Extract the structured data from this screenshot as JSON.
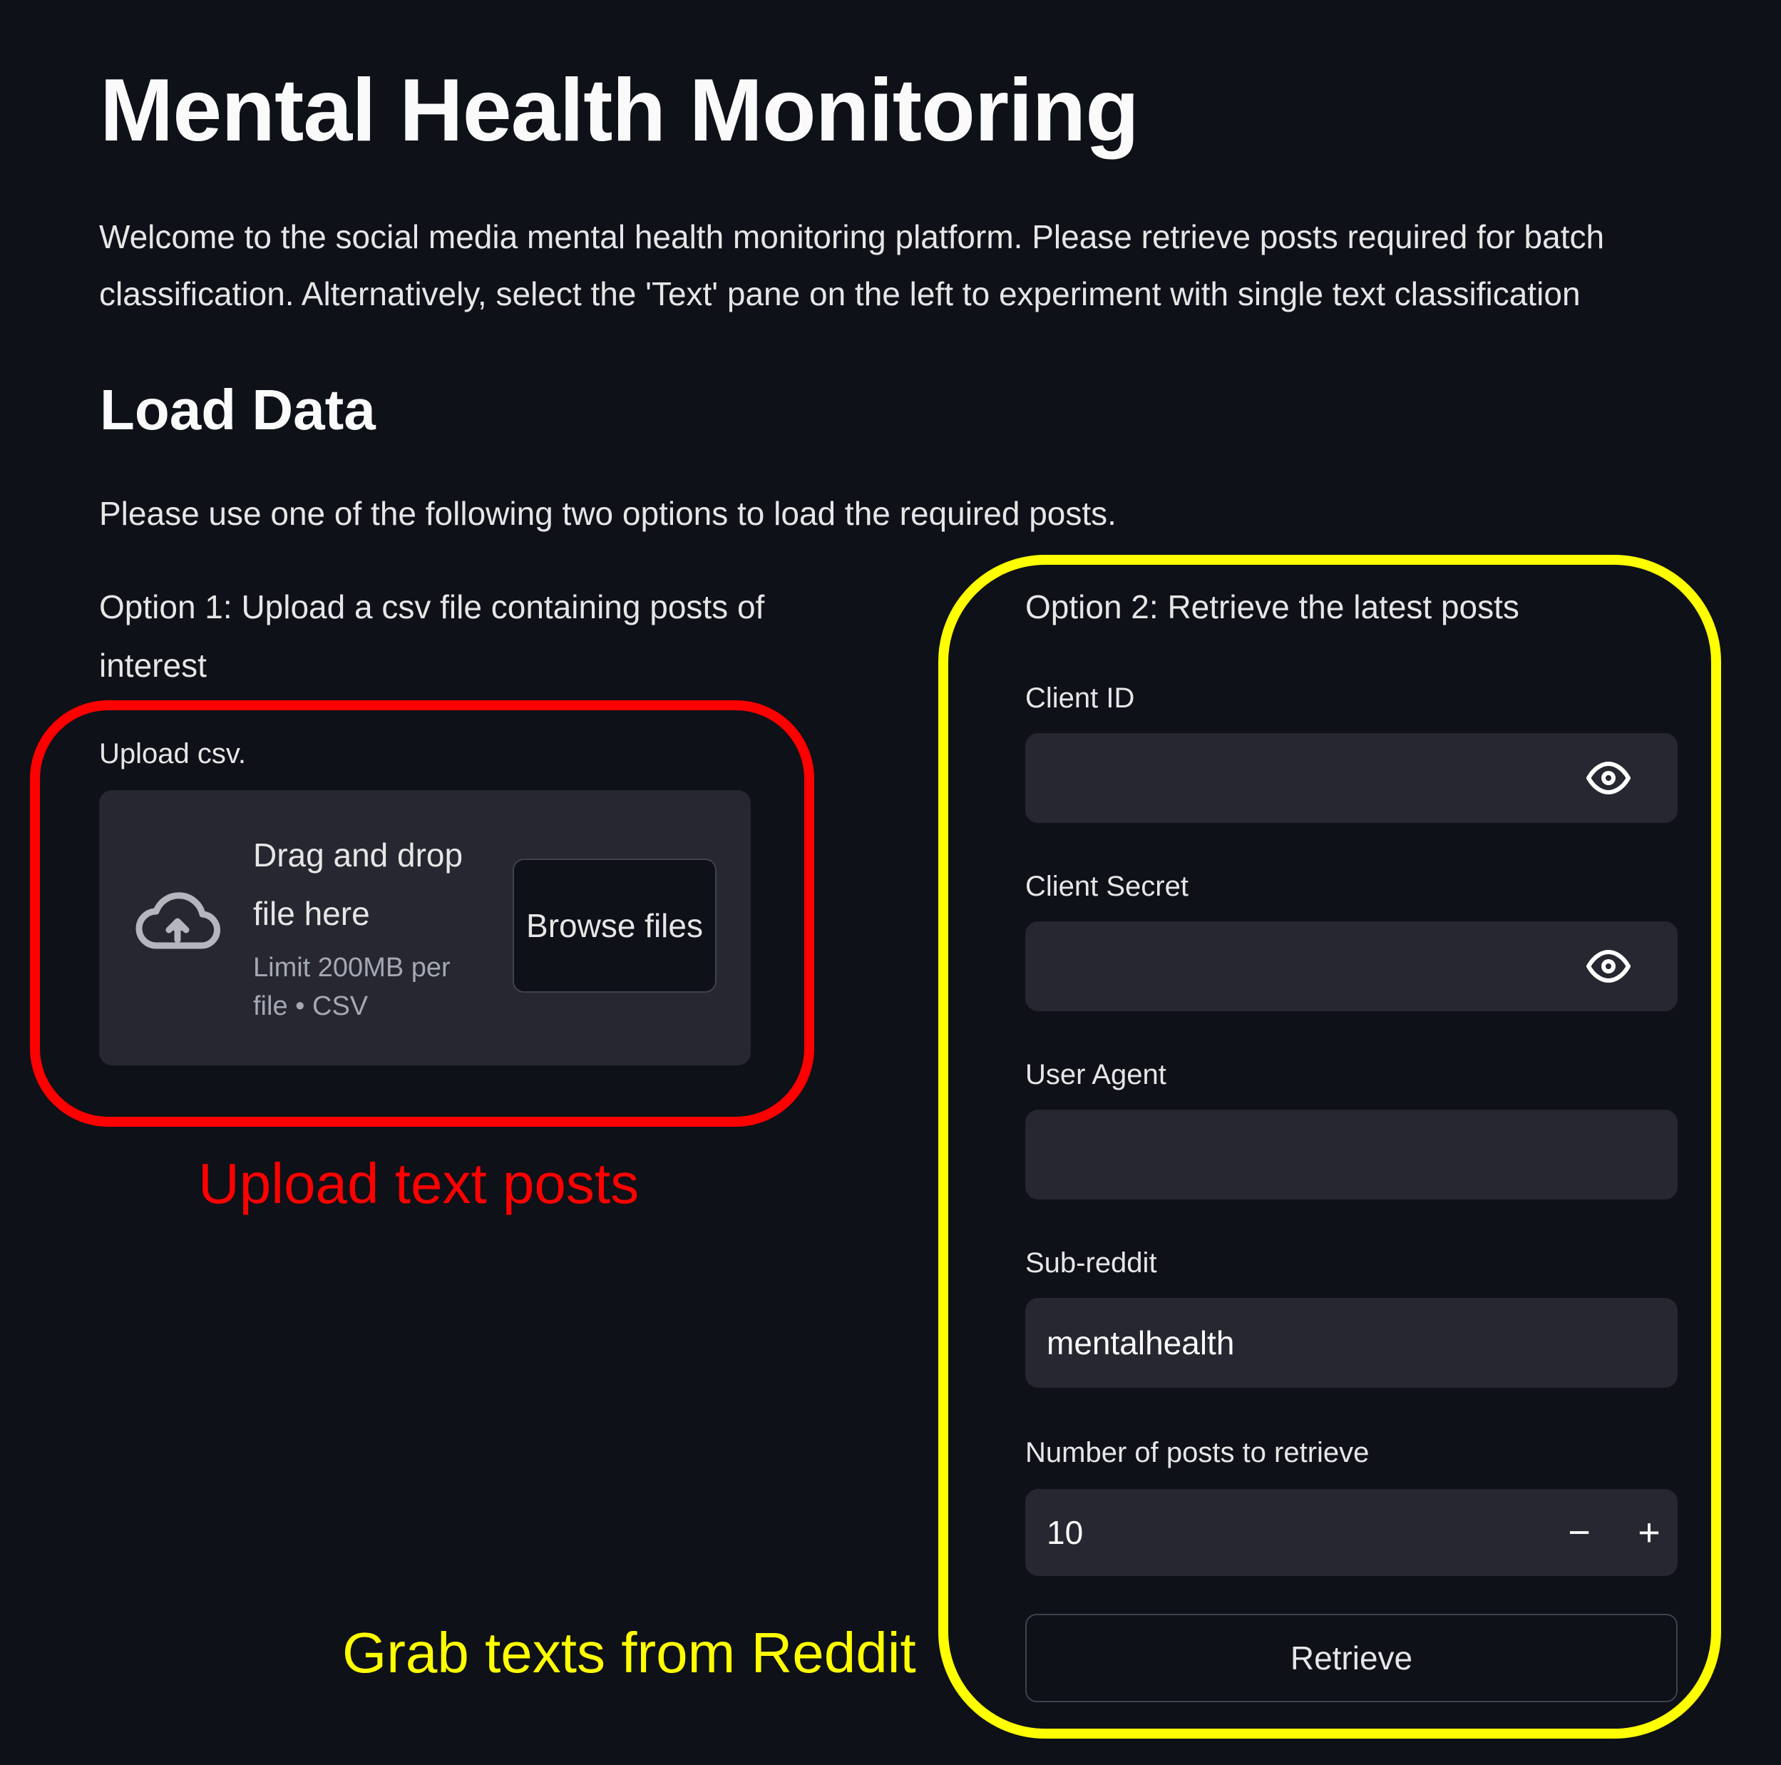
{
  "page": {
    "title": "Mental Health Monitoring",
    "intro": "Welcome to the social media mental health monitoring platform. Please retrieve posts required for batch classification. Alternatively, select the 'Text' pane on the left to experiment with single text classification"
  },
  "load_data": {
    "heading": "Load Data",
    "description": "Please use one of the following two options to load the required posts."
  },
  "option1": {
    "heading": "Option 1: Upload a csv file containing posts of interest",
    "upload_label": "Upload csv.",
    "drag_drop": "Drag and drop file here",
    "limit": "Limit 200MB per file • CSV",
    "browse_label": "Browse files",
    "icon": "cloud-upload-icon"
  },
  "option2": {
    "heading": "Option 2: Retrieve the latest posts",
    "client_id": {
      "label": "Client ID",
      "value": ""
    },
    "client_secret": {
      "label": "Client Secret",
      "value": ""
    },
    "user_agent": {
      "label": "User Agent",
      "value": ""
    },
    "subreddit": {
      "label": "Sub-reddit",
      "value": "mentalhealth"
    },
    "num_posts": {
      "label": "Number of posts to retrieve",
      "value": "10",
      "decrement": "−",
      "increment": "+"
    },
    "retrieve_label": "Retrieve"
  },
  "annotations": {
    "red": {
      "text": "Upload text posts",
      "color": "#ff0000"
    },
    "yellow": {
      "text": "Grab texts from Reddit",
      "color": "#ffff00"
    }
  },
  "colors": {
    "background": "#0e1117",
    "input_bg": "#262730",
    "text": "#fafafa"
  }
}
